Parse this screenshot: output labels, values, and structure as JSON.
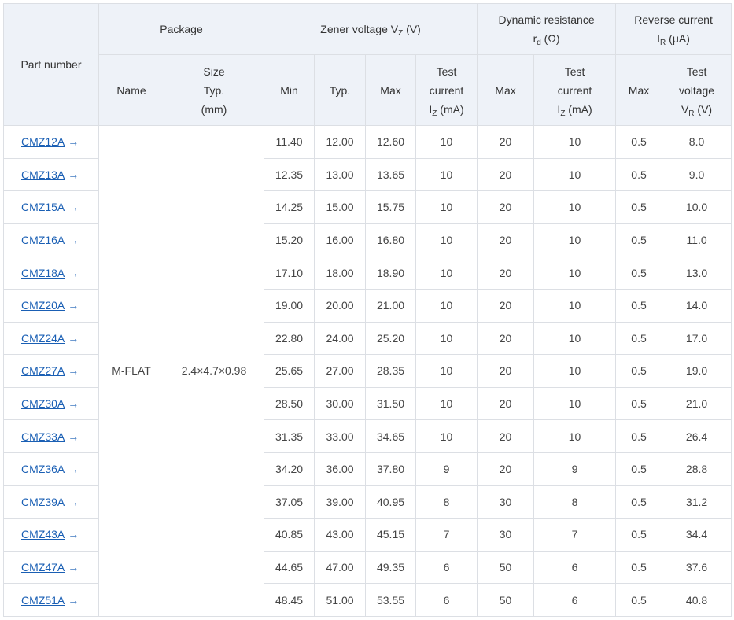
{
  "headers": {
    "part_number": "Part number",
    "package": "Package",
    "package_name": "Name",
    "package_size_l1": "Size",
    "package_size_l2": "Typ.",
    "package_size_l3": "(mm)",
    "zener_main": "Zener voltage V",
    "zener_sub": "Z",
    "zener_unit": " (V)",
    "zener_min": "Min",
    "zener_typ": "Typ.",
    "zener_max": "Max",
    "test_l1": "Test",
    "test_l2": "current",
    "test_iz_main": "I",
    "test_iz_sub": "Z",
    "test_iz_unit": " (mA)",
    "dyn_l1": "Dynamic resistance",
    "dyn_r_main": "r",
    "dyn_r_sub": "d",
    "dyn_r_unit": " (Ω)",
    "dyn_max": "Max",
    "dyn_test_l1": "Test",
    "dyn_test_l2": "current",
    "dyn_iz_main": "I",
    "dyn_iz_sub": "Z",
    "dyn_iz_unit": " (mA)",
    "rev_l1": "Reverse current",
    "rev_i_main": "I",
    "rev_i_sub": "R",
    "rev_i_unit": " (μA)",
    "rev_max": "Max",
    "rev_test_l1": "Test",
    "rev_test_l2": "voltage",
    "rev_v_main": "V",
    "rev_v_sub": "R",
    "rev_v_unit": " (V)"
  },
  "package": {
    "name": "M-FLAT",
    "size": "2.4×4.7×0.98"
  },
  "arrow_glyph": "→",
  "rows": [
    {
      "part": "CMZ12A",
      "vmin": "11.40",
      "vtyp": "12.00",
      "vmax": "12.60",
      "iz": "10",
      "rd": "20",
      "rd_iz": "10",
      "ir": "0.5",
      "vr": "8.0"
    },
    {
      "part": "CMZ13A",
      "vmin": "12.35",
      "vtyp": "13.00",
      "vmax": "13.65",
      "iz": "10",
      "rd": "20",
      "rd_iz": "10",
      "ir": "0.5",
      "vr": "9.0"
    },
    {
      "part": "CMZ15A",
      "vmin": "14.25",
      "vtyp": "15.00",
      "vmax": "15.75",
      "iz": "10",
      "rd": "20",
      "rd_iz": "10",
      "ir": "0.5",
      "vr": "10.0"
    },
    {
      "part": "CMZ16A",
      "vmin": "15.20",
      "vtyp": "16.00",
      "vmax": "16.80",
      "iz": "10",
      "rd": "20",
      "rd_iz": "10",
      "ir": "0.5",
      "vr": "11.0"
    },
    {
      "part": "CMZ18A",
      "vmin": "17.10",
      "vtyp": "18.00",
      "vmax": "18.90",
      "iz": "10",
      "rd": "20",
      "rd_iz": "10",
      "ir": "0.5",
      "vr": "13.0"
    },
    {
      "part": "CMZ20A",
      "vmin": "19.00",
      "vtyp": "20.00",
      "vmax": "21.00",
      "iz": "10",
      "rd": "20",
      "rd_iz": "10",
      "ir": "0.5",
      "vr": "14.0"
    },
    {
      "part": "CMZ24A",
      "vmin": "22.80",
      "vtyp": "24.00",
      "vmax": "25.20",
      "iz": "10",
      "rd": "20",
      "rd_iz": "10",
      "ir": "0.5",
      "vr": "17.0"
    },
    {
      "part": "CMZ27A",
      "vmin": "25.65",
      "vtyp": "27.00",
      "vmax": "28.35",
      "iz": "10",
      "rd": "20",
      "rd_iz": "10",
      "ir": "0.5",
      "vr": "19.0"
    },
    {
      "part": "CMZ30A",
      "vmin": "28.50",
      "vtyp": "30.00",
      "vmax": "31.50",
      "iz": "10",
      "rd": "20",
      "rd_iz": "10",
      "ir": "0.5",
      "vr": "21.0"
    },
    {
      "part": "CMZ33A",
      "vmin": "31.35",
      "vtyp": "33.00",
      "vmax": "34.65",
      "iz": "10",
      "rd": "20",
      "rd_iz": "10",
      "ir": "0.5",
      "vr": "26.4"
    },
    {
      "part": "CMZ36A",
      "vmin": "34.20",
      "vtyp": "36.00",
      "vmax": "37.80",
      "iz": "9",
      "rd": "20",
      "rd_iz": "9",
      "ir": "0.5",
      "vr": "28.8"
    },
    {
      "part": "CMZ39A",
      "vmin": "37.05",
      "vtyp": "39.00",
      "vmax": "40.95",
      "iz": "8",
      "rd": "30",
      "rd_iz": "8",
      "ir": "0.5",
      "vr": "31.2"
    },
    {
      "part": "CMZ43A",
      "vmin": "40.85",
      "vtyp": "43.00",
      "vmax": "45.15",
      "iz": "7",
      "rd": "30",
      "rd_iz": "7",
      "ir": "0.5",
      "vr": "34.4"
    },
    {
      "part": "CMZ47A",
      "vmin": "44.65",
      "vtyp": "47.00",
      "vmax": "49.35",
      "iz": "6",
      "rd": "50",
      "rd_iz": "6",
      "ir": "0.5",
      "vr": "37.6"
    },
    {
      "part": "CMZ51A",
      "vmin": "48.45",
      "vtyp": "51.00",
      "vmax": "53.55",
      "iz": "6",
      "rd": "50",
      "rd_iz": "6",
      "ir": "0.5",
      "vr": "40.8"
    }
  ]
}
